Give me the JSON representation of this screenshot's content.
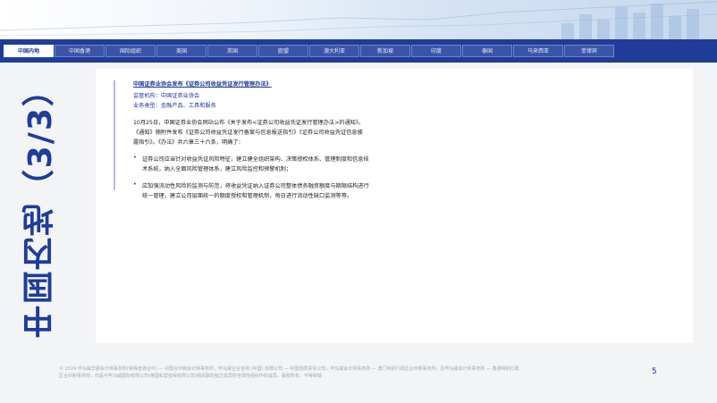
{
  "tabs": [
    {
      "label": "中国内地",
      "active": true
    },
    {
      "label": "中国香港",
      "active": false
    },
    {
      "label": "国际组织",
      "active": false
    },
    {
      "label": "美国",
      "active": false
    },
    {
      "label": "英国",
      "active": false
    },
    {
      "label": "欧盟",
      "active": false
    },
    {
      "label": "澳大利亚",
      "active": false
    },
    {
      "label": "新加坡",
      "active": false
    },
    {
      "label": "印度",
      "active": false
    },
    {
      "label": "泰国",
      "active": false
    },
    {
      "label": "马来西亚",
      "active": false
    },
    {
      "label": "菲律宾",
      "active": false
    }
  ],
  "side_title": "中国内地（3/3）",
  "article": {
    "title_link": "中国证券业协会发布《证券公司收益凭证发行管理办法》",
    "regulator": "监管机构：中国证券业协会",
    "business_type": "业务类型：金融产品、工具和服务",
    "para_lines": [
      "10月25日，中国证券业协会网站公布《关于发布<证券公司收益凭证发行管理办法>的通知》。",
      "《通知》随附件发布《证券公司收益凭证发行备案与信息报送指引》《证券公司收益凭证信息披",
      "露指引》。《办法》共六章三十六条，明确了："
    ],
    "bullets": [
      {
        "lines": [
          "证券公司应当针对收益凭证风险特征，建立健全组织架构、决策授权体系、管理制度和信息技",
          "术系统，纳入全面风险管理体系，建立风险监控和预警机制；"
        ]
      },
      {
        "lines": [
          "应加强流动性风险的监测与防范，将收益凭证纳入证券公司整体债务融资额度与期限结构进行",
          "统一管理，建立公司层面统一的额度授权和管理机制，每日进行流动性缺口监测等等。"
        ]
      }
    ]
  },
  "footer": {
    "line1": "© 2024 毕马威华振会计师事务所(特殊普通合伙) — 中国合伙制会计师事务所，毕马威企业咨询 (中国) 有限公司 — 中国有限责任公司，毕马威会计师事务所 — 澳门特别行政区合伙制事务所，及毕马威会计师事务所 — 香港特别行政",
    "line2": "区合伙制事务所，均是与毕马威国际有限公司(英国私营担保有限公司)相关联的独立成员所全球性组织中的成员。版权所有，不得转载"
  },
  "page_number": "5",
  "colors": {
    "brand": "#1f3c9a",
    "accent_bar": "#b8b6e8"
  }
}
